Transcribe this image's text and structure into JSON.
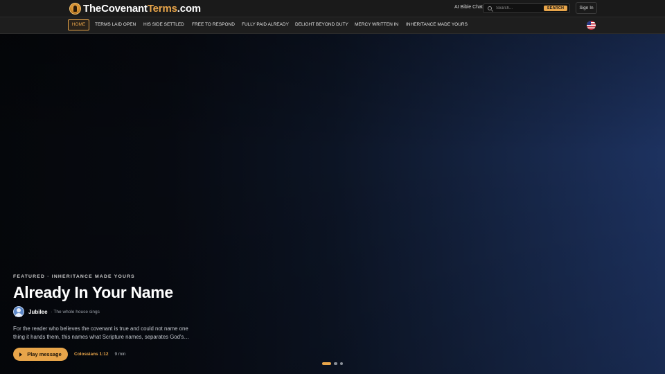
{
  "header": {
    "brand": {
      "part1": "TheCovenant",
      "part2": "Terms",
      "part3": ".com"
    },
    "chat_link": "AI Bible Chat",
    "search": {
      "placeholder": "Search...",
      "button_label": "SEARCH"
    },
    "signin_label": "Sign In"
  },
  "nav": {
    "items": [
      {
        "label": "HOME",
        "active": true
      },
      {
        "label": "TERMS LAID OPEN",
        "active": false
      },
      {
        "label": "HIS SIDE SETTLED",
        "active": false
      },
      {
        "label": "FREE TO RESPOND",
        "active": false
      },
      {
        "label": "FULLY PAID ALREADY",
        "active": false
      },
      {
        "label": "DELIGHT BEYOND DUTY",
        "active": false
      },
      {
        "label": "MERCY WRITTEN IN",
        "active": false
      },
      {
        "label": "INHERITANCE MADE YOURS",
        "active": false
      }
    ],
    "language_icon": "us-flag-icon"
  },
  "hero": {
    "eyebrow": "FEATURED · INHERITANCE MADE YOURS",
    "title": "Already In Your Name",
    "author": {
      "name": "Jubilee",
      "subtitle": "· The whole house sings"
    },
    "description": "For the reader who believes the covenant is true and could not name one thing it hands them, this names what Scripture names, separates God's…",
    "play_label": "Play message",
    "scripture_ref": "Colossians 1:12",
    "duration": "9 min",
    "carousel": {
      "count": 3,
      "active_index": 0
    }
  },
  "colors": {
    "accent": "#e8a54a",
    "header_bg": "#1a1a1a",
    "nav_bg": "#1e1e1e",
    "hero_gradient_start": "#05070b",
    "hero_gradient_end": "#1d3260"
  }
}
